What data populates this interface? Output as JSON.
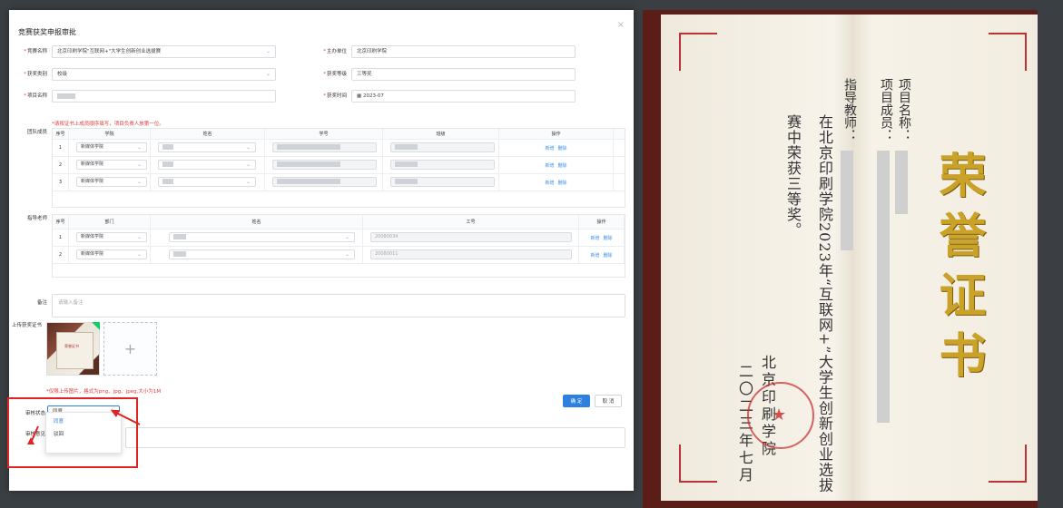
{
  "dialog": {
    "title": "竞赛获奖申报审批",
    "close": "×"
  },
  "form": {
    "competition_label": "竞赛名称",
    "competition_value": "北京印刷学院\"互联网+\"大学生创新创业选拔赛",
    "host_label": "主办单位",
    "host_value": "北京印刷学院",
    "award_type_label": "获奖类别",
    "award_type_value": "校级",
    "award_level_label": "获奖等级",
    "award_level_value": "三等奖",
    "project_label": "项目名称",
    "award_time_label": "获奖时间",
    "award_time_value": "2023-07"
  },
  "team": {
    "label": "团队成员",
    "note": "*请按证书上成员顺序填写，项目负责人放第一位。",
    "headers": [
      "序号",
      "学院",
      "姓名",
      "学号",
      "班级",
      "操作"
    ],
    "rows": [
      {
        "no": "1",
        "college": "新媒体学院"
      },
      {
        "no": "2",
        "college": "新媒体学院"
      },
      {
        "no": "3",
        "college": "新媒体学院"
      }
    ],
    "action_add": "新增",
    "action_del": "删除"
  },
  "teachers": {
    "label": "指导老师",
    "headers": [
      "序号",
      "部门",
      "姓名",
      "工号",
      "操作"
    ],
    "rows": [
      {
        "no": "1",
        "dept": "新媒体学院",
        "id": "20080034"
      },
      {
        "no": "2",
        "dept": "新媒体学院",
        "id": "20080011"
      }
    ]
  },
  "remark": {
    "label": "备注",
    "placeholder": "请输入备注"
  },
  "upload": {
    "label": "上传获奖证书",
    "hint": "*仅限上传图片，格式为png、jpg、jpeg,大小为1M",
    "plus": "+",
    "thumb_text": "荣誉证书"
  },
  "review": {
    "status_label": "审核状态",
    "status_value": "同意",
    "opinion_label": "审核意见",
    "options": [
      "同意",
      "驳回"
    ]
  },
  "buttons": {
    "confirm": "确 定",
    "cancel": "取 消"
  },
  "certificate": {
    "heading": "荣誉证书",
    "line_project": "项目名称：",
    "line_members": "项目成员：",
    "line_teacher": "指导教师：",
    "line_body1": "在北京印刷学院2023年“互联网+”大学生创新创业选拔",
    "line_body2": "赛中荣获三等奖。",
    "issuer": "北京印刷学院",
    "date": "二〇二三年七月"
  },
  "colors": {
    "primary": "#2d7fe0",
    "danger": "#e23b3b",
    "gold": "#c9a227"
  }
}
